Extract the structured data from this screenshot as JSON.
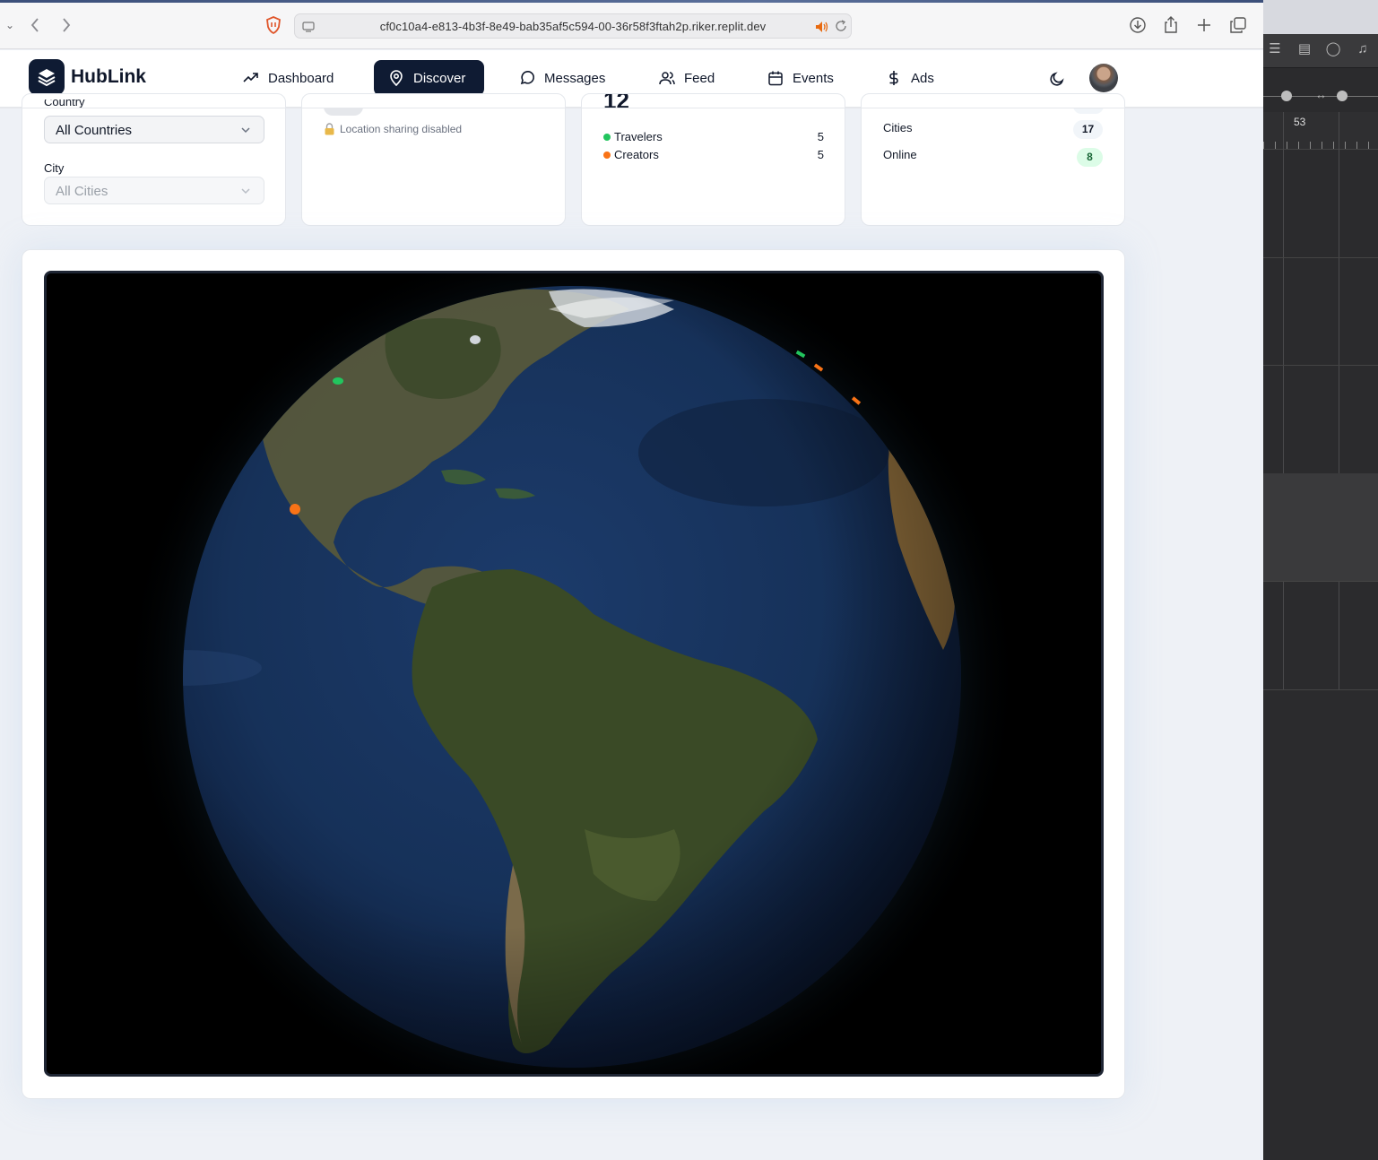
{
  "browser": {
    "url": "cf0c10a4-e813-4b3f-8e49-bab35af5c594-00-36r58f3ftah2p.riker.replit.dev"
  },
  "nav": {
    "brand": "HubLink",
    "items": [
      {
        "label": "Dashboard",
        "icon": "trending-up-icon"
      },
      {
        "label": "Discover",
        "icon": "map-pin-icon",
        "active": true
      },
      {
        "label": "Messages",
        "icon": "message-circle-icon"
      },
      {
        "label": "Feed",
        "icon": "users-icon"
      },
      {
        "label": "Events",
        "icon": "calendar-icon"
      },
      {
        "label": "Ads",
        "icon": "dollar-icon"
      }
    ]
  },
  "filters": {
    "country_label": "Country",
    "country_value": "All Countries",
    "city_label": "City",
    "city_value": "All Cities"
  },
  "location": {
    "status": "Location sharing disabled"
  },
  "users_card": {
    "total": "12",
    "rows": [
      {
        "label": "Travelers",
        "value": "5",
        "color": "#22c55e"
      },
      {
        "label": "Creators",
        "value": "5",
        "color": "#f97316"
      }
    ]
  },
  "stats_card": {
    "rows": [
      {
        "label": "Cities",
        "value": "17"
      },
      {
        "label": "Online",
        "value": "8"
      }
    ]
  },
  "right_app": {
    "ruler_number": "53"
  },
  "colors": {
    "nav_active": "#0f1b33",
    "traveler": "#22c55e",
    "creator": "#f97316",
    "online_pill": "#dcfce7"
  }
}
